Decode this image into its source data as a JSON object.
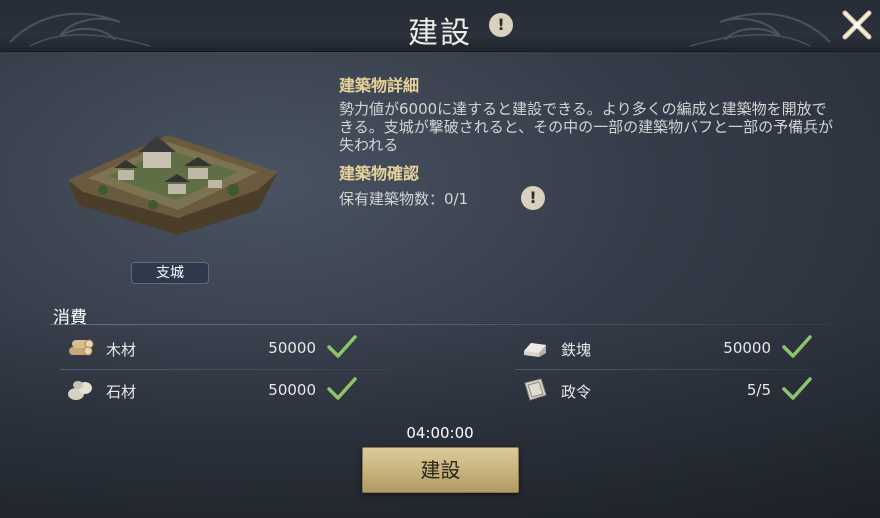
{
  "header": {
    "title": "建設",
    "info_glyph": "!"
  },
  "building": {
    "name": "支城"
  },
  "details": {
    "heading": "建築物詳細",
    "description": "勢力値が6000に達すると建設できる。より多くの編成と建築物を開放できる。支城が撃破されると、その中の一部の建築物バフと一部の予備兵が失われる",
    "confirm_heading": "建築物確認",
    "owned_count": "保有建築物数：0/1",
    "info_glyph": "!"
  },
  "consumption": {
    "heading": "消費",
    "items": [
      {
        "name": "木材",
        "amount": "50000",
        "icon": "wood-icon",
        "met": true
      },
      {
        "name": "鉄塊",
        "amount": "50000",
        "icon": "iron-icon",
        "met": true
      },
      {
        "name": "石材",
        "amount": "50000",
        "icon": "stone-icon",
        "met": true
      },
      {
        "name": "政令",
        "amount": "5/5",
        "icon": "decree-icon",
        "met": true
      }
    ]
  },
  "timer": "04:00:00",
  "build_button": {
    "label": "建設"
  },
  "colors": {
    "accent_gold": "#e6d29a",
    "check_green": "#8fc46a",
    "button_gold": "#c6b27c"
  }
}
